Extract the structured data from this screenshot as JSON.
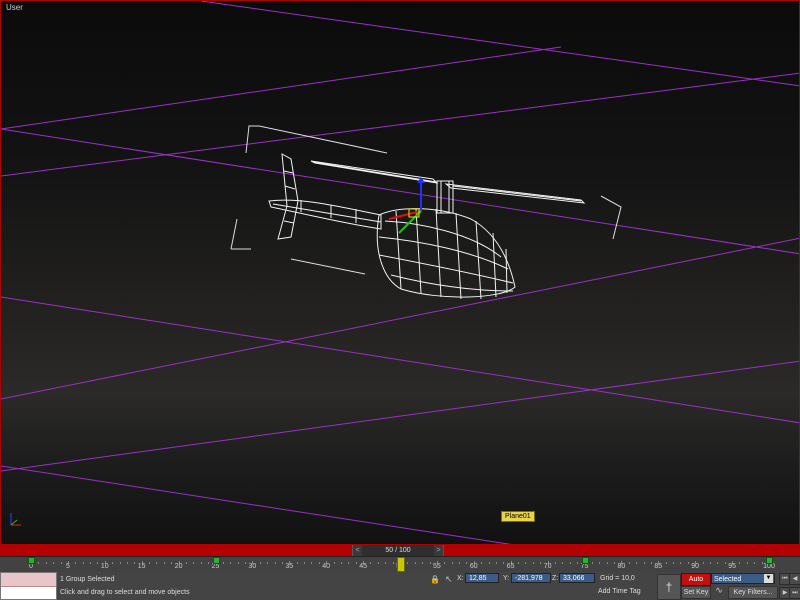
{
  "viewport": {
    "label": "User",
    "object_tag": "Plane01"
  },
  "timeline": {
    "frame_display": "50 / 100",
    "prev_label": "<",
    "next_label": ">",
    "ticks": [
      "0",
      "5",
      "10",
      "15",
      "20",
      "25",
      "30",
      "35",
      "40",
      "45",
      "50",
      "55",
      "60",
      "65",
      "70",
      "75",
      "80",
      "85",
      "90",
      "95",
      "100"
    ],
    "current_frame": 50,
    "keyframes": [
      0,
      25,
      50,
      75,
      100
    ]
  },
  "status": {
    "selection": "1 Group Selected",
    "prompt": "Click and drag to select and move objects",
    "x_label": "X:",
    "x_value": "12,85",
    "y_label": "Y:",
    "y_value": "-281,978",
    "z_label": "Z:",
    "z_value": "33,066",
    "grid": "Grid = 10,0",
    "add_time_tag": "Add Time Tag",
    "auto_key": "Auto Key",
    "selected_dropdown": "Selected",
    "set_key": "Set Key",
    "key_filters": "Key Filters..."
  },
  "colors": {
    "timebar": "#b40000",
    "grid_lines": "#9b30c8",
    "auto_key": "#c21010",
    "tag": "#e8d44a"
  },
  "icons": [
    "lock-icon",
    "selection-mode-icon",
    "key-icon",
    "curve-editor-icon",
    "dropdown-arrow-icon",
    "axis-tripod-icon",
    "transform-gizmo-icon"
  ]
}
